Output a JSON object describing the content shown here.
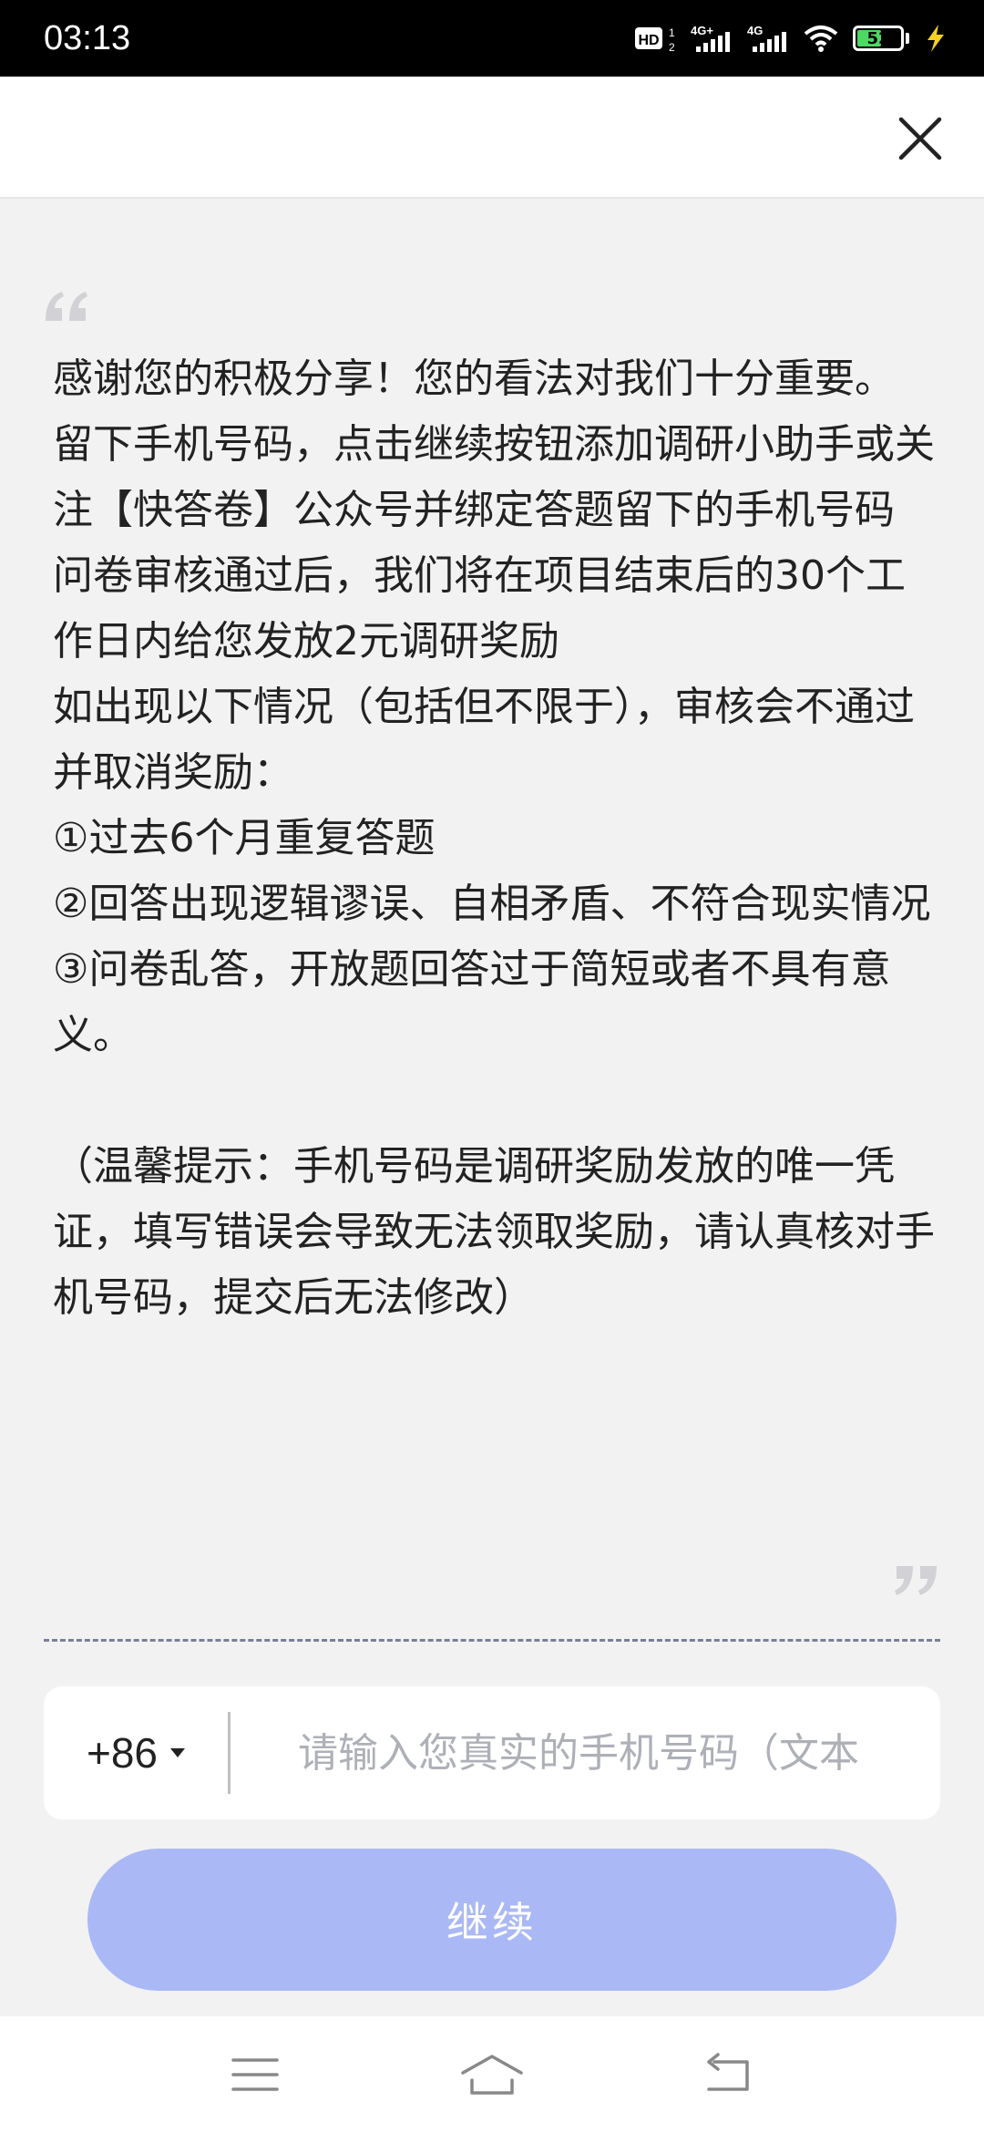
{
  "status_bar": {
    "time": "03:13",
    "battery_level": "52",
    "battery_fraction": 0.52,
    "icons": [
      "hd-icon",
      "signal-4g-plus-icon",
      "signal-4g-icon",
      "wifi-icon",
      "battery-icon",
      "charging-icon"
    ]
  },
  "topbar": {
    "close_icon": "close-icon"
  },
  "message": {
    "paragraphs": [
      "感谢您的积极分享！您的看法对我们十分重要。",
      "留下手机号码，点击继续按钮添加调研小助手或关注【快答卷】公众号并绑定答题留下的手机号码",
      "问卷审核通过后，我们将在项目结束后的30个工作日内给您发放2元调研奖励",
      "如出现以下情况（包括但不限于），审核会不通过并取消奖励：",
      "①过去6个月重复答题",
      "②回答出现逻辑谬误、自相矛盾、不符合现实情况",
      "③问卷乱答，开放题回答过于简短或者不具有意义。",
      "",
      "（温馨提示：手机号码是调研奖励发放的唯一凭证，填写错误会导致无法领取奖励，请认真核对手机号码，提交后无法修改）"
    ]
  },
  "phone": {
    "country_code": "+86",
    "value": "",
    "placeholder": "请输入您真实的手机号码（文本"
  },
  "continue_button": {
    "label": "继续",
    "color": "#aab8f5"
  },
  "navbar": {
    "icons": [
      "menu-icon",
      "home-icon",
      "back-icon"
    ]
  }
}
